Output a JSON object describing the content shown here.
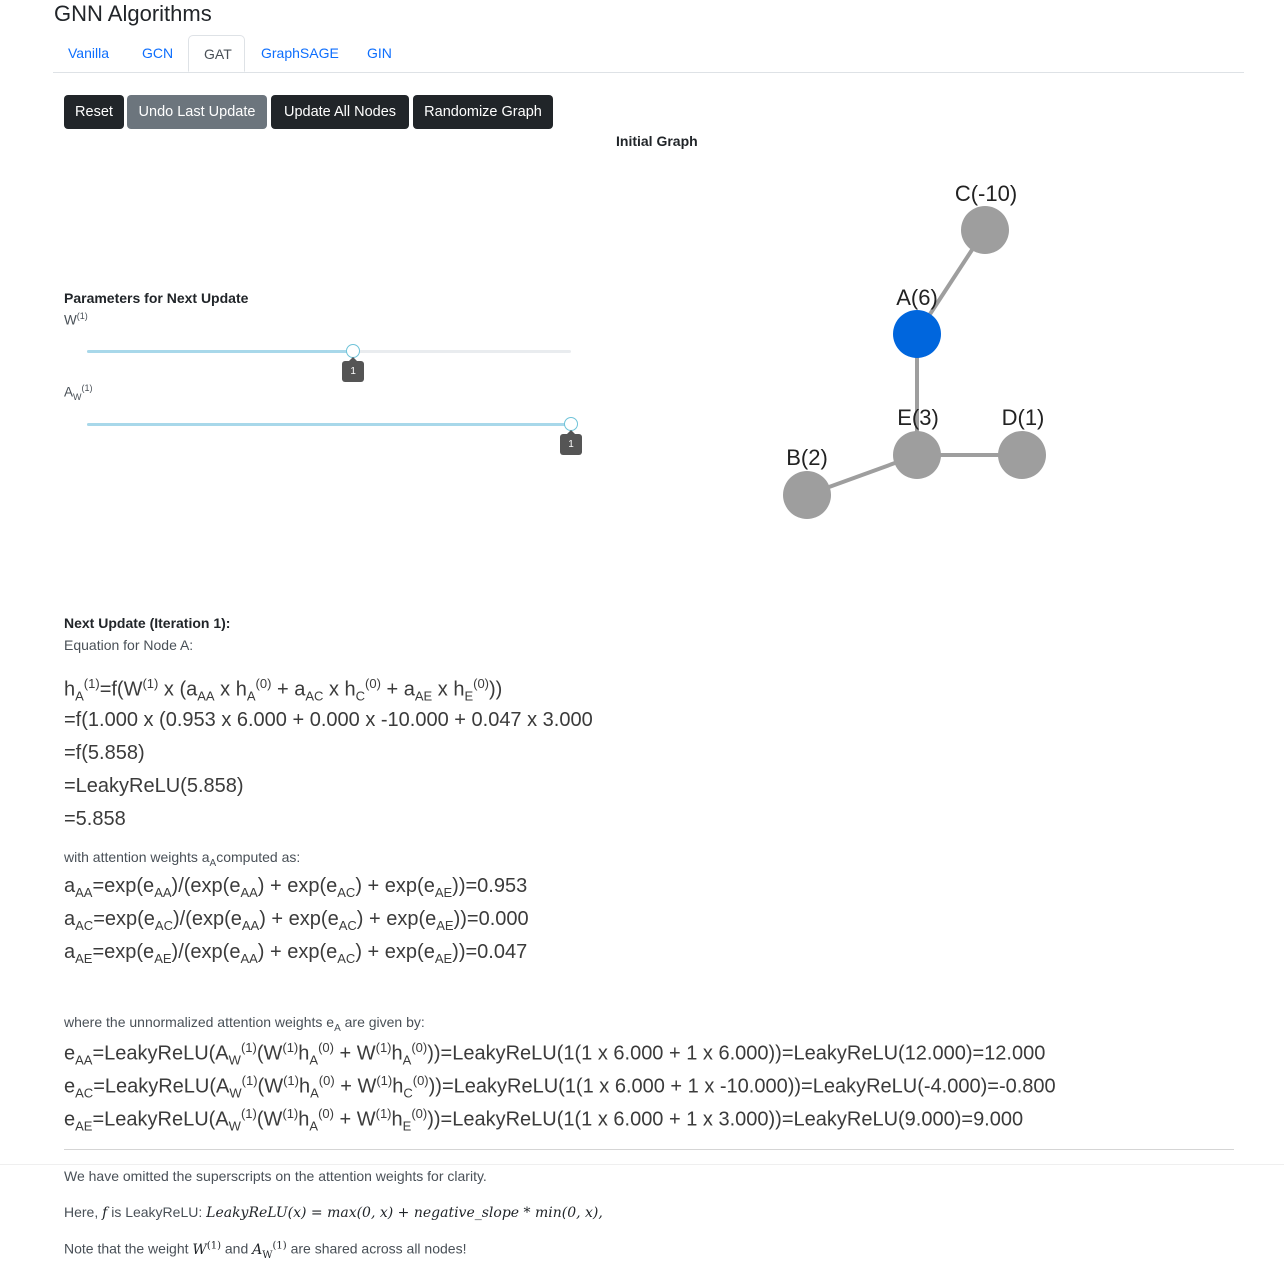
{
  "page": {
    "title": "GNN Algorithms"
  },
  "tabs": [
    {
      "label": "Vanilla",
      "active": false
    },
    {
      "label": "GCN",
      "active": false
    },
    {
      "label": "GAT",
      "active": true
    },
    {
      "label": "GraphSAGE",
      "active": false
    },
    {
      "label": "GIN",
      "active": false
    }
  ],
  "toolbar": {
    "reset": "Reset",
    "undo": "Undo Last Update",
    "update_all": "Update All Nodes",
    "randomize": "Randomize Graph"
  },
  "graph": {
    "title": "Initial Graph",
    "nodes": [
      {
        "id": "A",
        "label": "A(6)",
        "selected": true
      },
      {
        "id": "B",
        "label": "B(2)",
        "selected": false
      },
      {
        "id": "C",
        "label": "C(-10)",
        "selected": false
      },
      {
        "id": "D",
        "label": "D(1)",
        "selected": false
      },
      {
        "id": "E",
        "label": "E(3)",
        "selected": false
      }
    ],
    "edges": [
      [
        "A",
        "C"
      ],
      [
        "A",
        "E"
      ],
      [
        "E",
        "B"
      ],
      [
        "E",
        "D"
      ]
    ],
    "colors": {
      "node": "#9e9e9e",
      "selected": "#0066dd",
      "edge": "#9e9e9e"
    }
  },
  "params": {
    "heading": "Parameters for Next Update",
    "w": {
      "base": "W",
      "sup": "(1)",
      "value": "1",
      "fraction": 0.55
    },
    "aw": {
      "base": "A",
      "sub": "W",
      "sup": "(1)",
      "value": "1",
      "fraction": 1.0
    }
  },
  "update": {
    "heading": "Next Update (Iteration 1):",
    "subheading": "Equation for Node A:",
    "line2": "=f(1.000 x (0.953 x 6.000 + 0.000 x -10.000 + 0.047 x 3.000",
    "line3": "=f(5.858)",
    "line4": "=LeakyReLU(5.858)",
    "line5": "=5.858",
    "attn_intro": "with attention weights a",
    "attn_intro_sub": "A",
    "attn_intro_end": "computed as:",
    "unnorm_intro": "where the unnormalized attention weights e",
    "unnorm_intro_sub": "A",
    "unnorm_intro_end": " are given by:",
    "a_values": {
      "AA": "=0.953",
      "AC": "=0.000",
      "AE": "=0.047"
    },
    "e_tail": {
      "AA": "))=LeakyReLU(1(1 x 6.000 + 1 x 6.000))=LeakyReLU(12.000)=12.000",
      "AC": "))=LeakyReLU(1(1 x 6.000 + 1 x -10.000))=LeakyReLU(-4.000)=-0.800",
      "AE": "))=LeakyReLU(1(1 x 6.000 + 1 x 3.000))=LeakyReLU(9.000)=9.000"
    }
  },
  "notes": {
    "omitted": "We have omitted the superscripts on the attention weights for clarity.",
    "here_prefix": "Here, ",
    "here_mid": " is LeakyReLU: ",
    "formula": "LeakyReLU(x) = max(0, x) + negative_slope * min(0, x),",
    "shared_prefix": "Note that the weight ",
    "shared_and": " and ",
    "shared_suffix": " are shared across all nodes!"
  }
}
